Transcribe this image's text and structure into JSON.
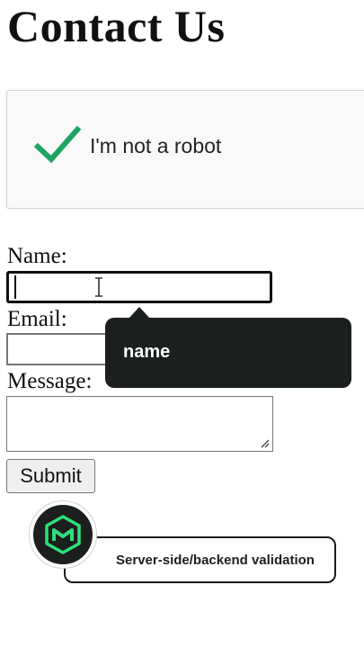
{
  "page": {
    "title": "Contact Us"
  },
  "captcha": {
    "label": "I'm not a robot",
    "checked": true,
    "check_color": "#1fa463"
  },
  "form": {
    "name_label": "Name:",
    "name_value": "",
    "email_label": "Email:",
    "email_value": "",
    "message_label": "Message:",
    "message_value": "",
    "submit_label": "Submit"
  },
  "tooltip": {
    "text": "name"
  },
  "overlay": {
    "caption": "Server-side/backend validation",
    "logo_icon": "cube-logo-icon",
    "accent": "#2ee07a",
    "dark": "#1b1f1d"
  }
}
